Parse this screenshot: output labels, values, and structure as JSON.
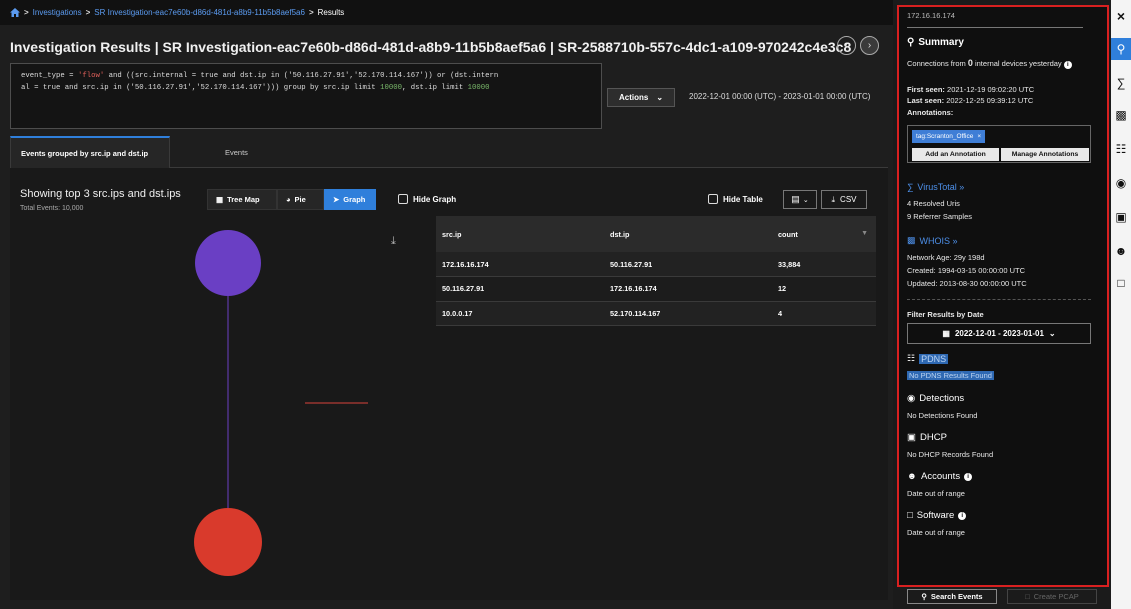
{
  "breadcrumb": {
    "items": [
      "Investigations",
      "SR Investigation-eac7e60b-d86d-481d-a8b9-11b5b8aef5a6",
      "Results"
    ]
  },
  "page": {
    "title": "Investigation Results | SR Investigation-eac7e60b-d86d-481d-a8b9-11b5b8aef5a6 | SR-2588710b-557c-4dc1-a109-970242c4e3c8"
  },
  "query": {
    "line1_a": "event_type = ",
    "line1_str": "'flow'",
    "line1_b": " and ((src.internal = true and dst.ip in ('50.116.27.91','52.170.114.167')) or (dst.intern",
    "line2_a": "al = true and src.ip in ('50.116.27.91','52.170.114.167'))) group by src.ip limit ",
    "line2_num1": "10000",
    "line2_b": ", dst.ip limit ",
    "line2_num2": "10000"
  },
  "toolbar": {
    "actions_label": "Actions",
    "date_range": "2022-12-01 00:00 (UTC) - 2023-01-01 00:00 (UTC)"
  },
  "tabs": [
    {
      "label": "Events grouped by src.ip and dst.ip",
      "active": true
    },
    {
      "label": "Events",
      "active": false
    }
  ],
  "results": {
    "showing": "Showing top 3 src.ips and dst.ips",
    "total_events": "Total Events: 10,000",
    "view_buttons": {
      "treemap": "Tree Map",
      "pie": "Pie",
      "graph": "Graph"
    },
    "active_view": "graph",
    "hide_graph_label": "Hide Graph",
    "hide_table_label": "Hide Table",
    "csv_label": "CSV"
  },
  "table": {
    "columns": [
      "src.ip",
      "dst.ip",
      "count"
    ],
    "rows": [
      [
        "172.16.16.174",
        "50.116.27.91",
        "33,884"
      ],
      [
        "50.116.27.91",
        "172.16.16.174",
        "12"
      ],
      [
        "10.0.0.17",
        "52.170.114.167",
        "4"
      ]
    ]
  },
  "graph": {
    "node_colors": [
      "#6a3fc4",
      "#d93a2c"
    ],
    "edge_color": "#6a3fc4",
    "short_edge_color": "#d9443a"
  },
  "sidebar": {
    "ip": "172.16.16.174",
    "summary_title": "Summary",
    "connections_a": "Connections from ",
    "connections_count": "0",
    "connections_b": " internal devices yesterday",
    "first_seen_label": "First seen:",
    "first_seen_value": "2021-12-19 09:02:20 UTC",
    "last_seen_label": "Last seen:",
    "last_seen_value": "2022-12-25 09:39:12 UTC",
    "annotations_label": "Annotations:",
    "annotation_tag": "tag:Scranton_Office",
    "add_annotation_label": "Add an Annotation",
    "manage_annotations_label": "Manage Annotations",
    "virustotal_label": "VirusTotal »",
    "resolved_uris": "4 Resolved Uris",
    "referrer_samples": "9 Referrer Samples",
    "whois_label": "WHOIS »",
    "network_age": "Network Age:  29y 198d",
    "created": "Created:  1994-03-15 00:00:00 UTC",
    "updated": "Updated:  2013-08-30 00:00:00 UTC",
    "filter_label": "Filter Results by Date",
    "filter_value": "2022-12-01  -  2023-01-01",
    "pdns_label": "PDNS",
    "pdns_status": "No PDNS Results Found",
    "detections_label": "Detections",
    "detections_status": "No Detections Found",
    "dhcp_label": "DHCP",
    "dhcp_status": "No DHCP Records Found",
    "accounts_label": "Accounts",
    "accounts_status": "Date out of range",
    "software_label": "Software",
    "software_status": "Date out of range",
    "search_events_label": "Search Events",
    "create_pcap_label": "Create PCAP"
  },
  "rail": {
    "icons": [
      "close-icon",
      "search-icon",
      "filter-icon",
      "building-icon",
      "network-icon",
      "shield-icon",
      "dhcp-icon",
      "user-icon",
      "window-icon"
    ]
  }
}
